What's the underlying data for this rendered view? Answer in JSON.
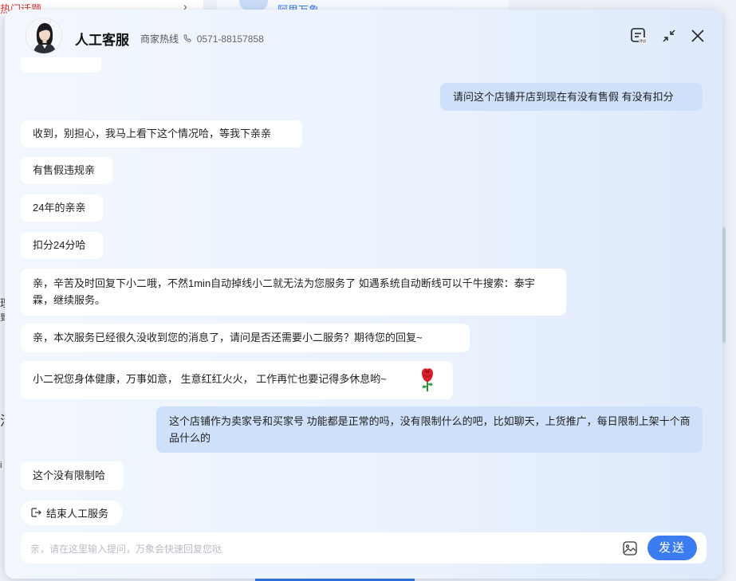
{
  "background": {
    "tab1_label": "热门话题",
    "tab1_chevron": "›",
    "tab2_label": "阿里万象",
    "side_chars": [
      "理",
      "到",
      "活",
      "i"
    ]
  },
  "header": {
    "title": "人工客服",
    "hotline_label": "商家热线",
    "hotline_number": "0571-88157858",
    "icons": [
      "feedback-icon",
      "minimize-icon",
      "close-icon"
    ],
    "feedback_icon_text": "评价"
  },
  "messages": [
    {
      "side": "left",
      "text": "收到，别担心，我马上看下这个情况哈，等我下亲亲"
    },
    {
      "side": "right",
      "text": "请问这个店铺开店到现在有没有售假 有没有扣分"
    },
    {
      "side": "left",
      "text": "有售假违规亲"
    },
    {
      "side": "left",
      "text": "24年的亲亲"
    },
    {
      "side": "left",
      "text": "扣分24分哈"
    },
    {
      "side": "left",
      "text": "亲，辛苦及时回复下小二哦，不然1min自动掉线小二就无法为您服务了 如遇系统自动断线可以千牛搜索：泰宇霖，继续服务。"
    },
    {
      "side": "left",
      "text": "亲，本次服务已经很久没收到您的消息了，请问是否还需要小二服务？期待您的回复~"
    },
    {
      "side": "left",
      "text": "小二祝您身体健康，万事如意， 生意红红火火， 工作再忙也要记得多休息哟~",
      "emoji": "rose-icon"
    },
    {
      "side": "right",
      "text": "这个店铺作为卖家号和买家号 功能都是正常的吗，没有限制什么的吧，比如聊天，上货推广，每日限制上架十个商品什么的"
    },
    {
      "side": "left",
      "text": "这个没有限制哈"
    }
  ],
  "end_service_label": "结束人工服务",
  "input": {
    "placeholder": "亲，请在这里输入提问，万象会快速回复您哒",
    "value": ""
  },
  "send_label": "发送",
  "colors": {
    "accent": "#3b7cf0",
    "user_bubble": "#cfe0fb",
    "agent_bubble": "#ffffff"
  }
}
